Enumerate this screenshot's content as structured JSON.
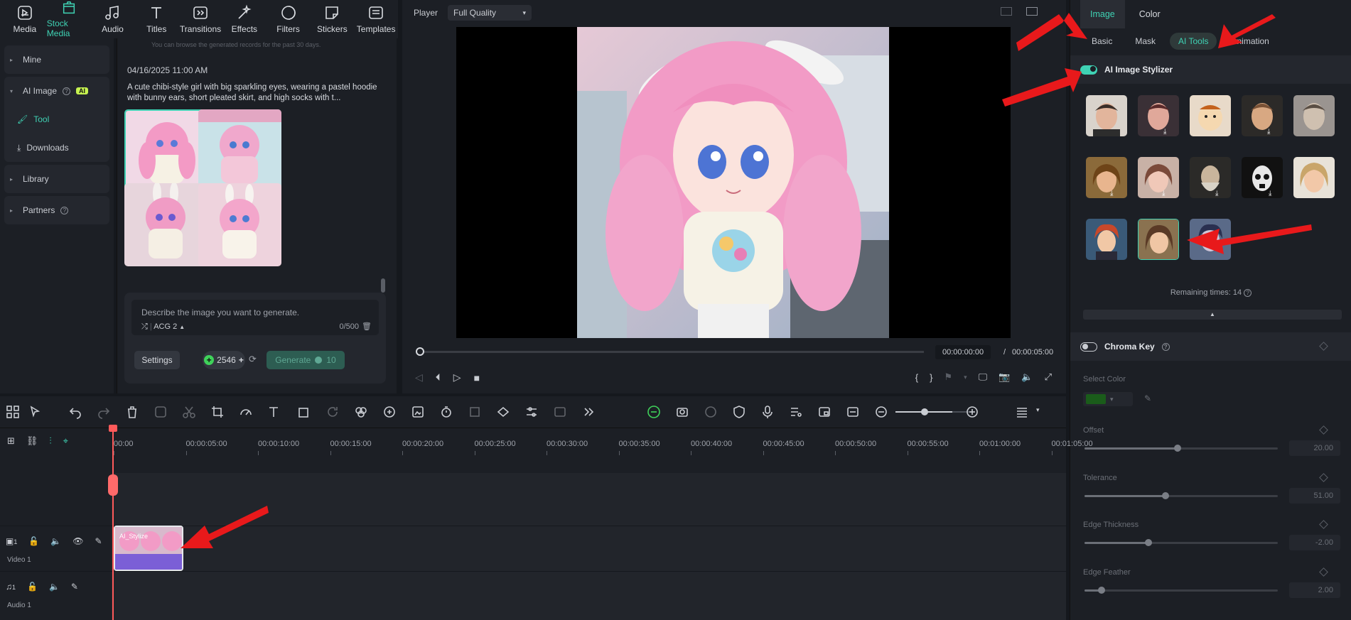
{
  "toolbar": {
    "items": [
      {
        "label": "Media",
        "icon": "media-icon"
      },
      {
        "label": "Stock Media",
        "icon": "stock-media-icon",
        "active": true
      },
      {
        "label": "Audio",
        "icon": "audio-icon"
      },
      {
        "label": "Titles",
        "icon": "titles-icon"
      },
      {
        "label": "Transitions",
        "icon": "transitions-icon"
      },
      {
        "label": "Effects",
        "icon": "effects-icon"
      },
      {
        "label": "Filters",
        "icon": "filters-icon"
      },
      {
        "label": "Stickers",
        "icon": "stickers-icon"
      },
      {
        "label": "Templates",
        "icon": "templates-icon"
      }
    ]
  },
  "leftnav": {
    "mine": "Mine",
    "ai_image": "AI Image",
    "ai_badge": "AI",
    "tool": "Tool",
    "downloads": "Downloads",
    "library": "Library",
    "partners": "Partners"
  },
  "gallery": {
    "hint": "You can browse the generated records for the past 30 days.",
    "date": "04/16/2025 11:00 AM",
    "prompt": "A cute chibi-style girl with big sparkling eyes, wearing a pastel hoodie with bunny ears, short pleated skirt, and high socks with t...",
    "input_placeholder": "Describe the image you want to generate.",
    "model": "ACG 2",
    "char_count": "0/500",
    "settings_label": "Settings",
    "credits": "2546",
    "generate_label": "Generate",
    "generate_cost": "10"
  },
  "player": {
    "label": "Player",
    "quality": "Full Quality",
    "current_time": "00:00:00:00",
    "separator": "/",
    "total_time": "00:00:05:00"
  },
  "rightpanel": {
    "tabs": [
      "Image",
      "Color"
    ],
    "active_tab": "Image",
    "subtabs": [
      "Basic",
      "Mask",
      "AI Tools",
      "Animation"
    ],
    "active_subtab": "AI Tools",
    "stylizer_label": "AI Image Stylizer",
    "stylizer_on": true,
    "remaining": "Remaining times: 14",
    "chroma_label": "Chroma Key",
    "chroma_on": false,
    "select_color_label": "Select Color",
    "selected_color": "#1a5c1a",
    "props": [
      {
        "label": "Offset",
        "value": "20.00",
        "level": 0.48
      },
      {
        "label": "Tolerance",
        "value": "51.00",
        "level": 0.42
      },
      {
        "label": "Edge Thickness",
        "value": "-2.00",
        "level": 0.33
      },
      {
        "label": "Edge Feather",
        "value": "2.00",
        "level": 0.09
      }
    ]
  },
  "timeline": {
    "ticks": [
      "00:00",
      "00:00:05:00",
      "00:00:10:00",
      "00:00:15:00",
      "00:00:20:00",
      "00:00:25:00",
      "00:00:30:00",
      "00:00:35:00",
      "00:00:40:00",
      "00:00:45:00",
      "00:00:50:00",
      "00:00:55:00",
      "00:01:00:00",
      "00:01:05:00"
    ],
    "video_track": "Video 1",
    "video_track_num": "1",
    "audio_track": "Audio 1",
    "audio_track_num": "1",
    "clip_label": "AI_Stylize"
  },
  "colors": {
    "accent": "#3fd2b4",
    "arrow": "#e8191b",
    "playhead": "#ff5a5a",
    "clip": "#7b5fd6"
  }
}
